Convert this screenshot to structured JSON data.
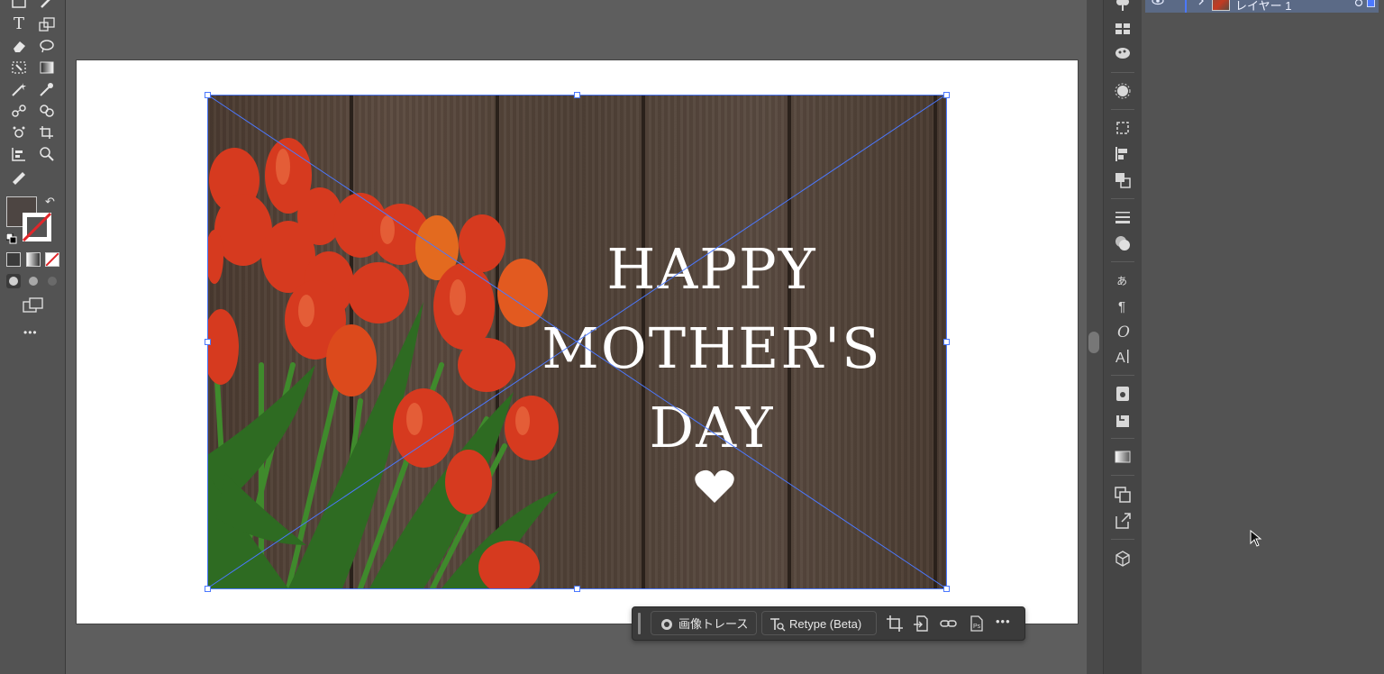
{
  "toolbar": {
    "tools": [
      "rectangle-tool",
      "paintbrush-tool",
      "type-tool",
      "scale-tool",
      "eraser-tool",
      "lasso-tool",
      "free-transform-tool",
      "gradient-tool",
      "magic-wand-tool",
      "eyedropper-tool",
      "blend-tool",
      "shape-builder-tool",
      "symbol-sprayer-tool",
      "artboard-tool",
      "column-graph-tool",
      "zoom-tool",
      "ruler-tool"
    ],
    "more_label": "•••",
    "fill_color": "#4d4542"
  },
  "canvas": {
    "headline_line1": "HAPPY",
    "headline_line2": "MOTHER'S",
    "headline_line3": "DAY"
  },
  "context_bar": {
    "trace_label": "画像トレース",
    "retype_label": "Retype (Beta)",
    "more_label": "•••"
  },
  "layers": {
    "layer_name": "レイヤー 1"
  },
  "colors": {
    "selection": "#4b78ff",
    "layer_highlight": "#5b6a86"
  }
}
